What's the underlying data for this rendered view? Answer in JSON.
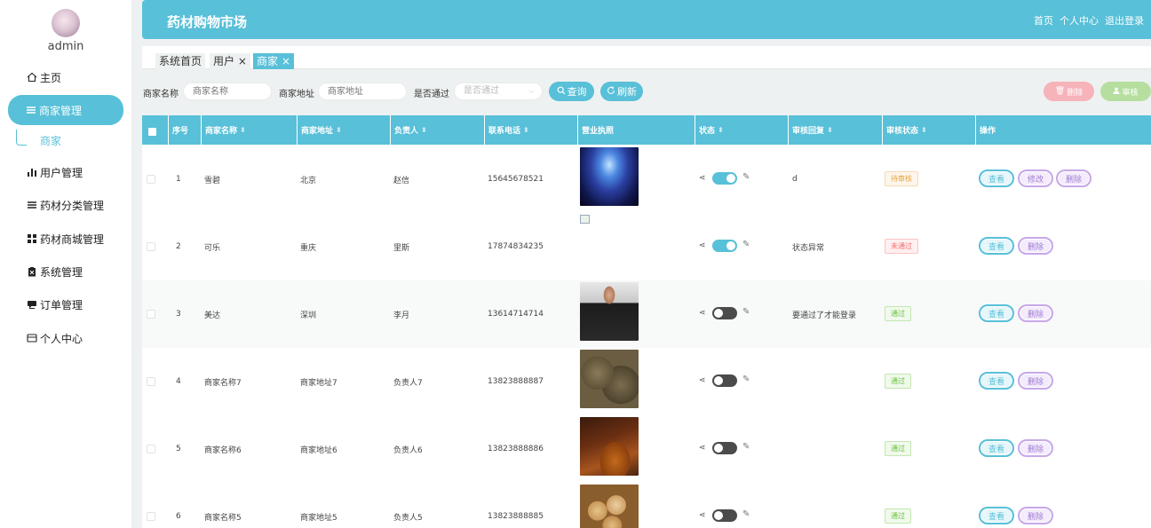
{
  "user": {
    "name": "admin"
  },
  "header": {
    "title": "药材购物市场",
    "links": [
      "首页",
      "个人中心",
      "退出登录"
    ]
  },
  "sidebar": {
    "items": [
      {
        "label": "主页",
        "icon": "home-icon"
      },
      {
        "label": "商家管理",
        "icon": "list-icon"
      },
      {
        "label": "用户管理",
        "icon": "bar-chart-icon"
      },
      {
        "label": "药材分类管理",
        "icon": "list-icon"
      },
      {
        "label": "药材商城管理",
        "icon": "grid-icon"
      },
      {
        "label": "系统管理",
        "icon": "clipboard-icon"
      },
      {
        "label": "订单管理",
        "icon": "chat-icon"
      },
      {
        "label": "个人中心",
        "icon": "card-icon"
      }
    ],
    "sub_item": "商家"
  },
  "tabs": [
    "系统首页",
    "用户",
    "商家"
  ],
  "filters": {
    "name_label": "商家名称",
    "name_placeholder": "商家名称",
    "address_label": "商家地址",
    "address_placeholder": "商家地址",
    "passed_label": "是否通过",
    "passed_placeholder": "是否通过",
    "query": "查询",
    "refresh": "刷新",
    "delete": "删除",
    "audit": "审核"
  },
  "table": {
    "columns": [
      "序号",
      "商家名称",
      "商家地址",
      "负责人",
      "联系电话",
      "营业执照",
      "状态",
      "审核回复",
      "审核状态",
      "操作"
    ],
    "rows": [
      {
        "no": "1",
        "name": "雪碧",
        "address": "北京",
        "owner": "赵信",
        "phone": "15645678521",
        "image": "galaxy",
        "status_on": true,
        "reply": "d",
        "audit": "待审核",
        "audit_type": "pending",
        "actions": [
          "查看",
          "修改",
          "删除"
        ]
      },
      {
        "no": "2",
        "name": "可乐",
        "address": "重庆",
        "owner": "里斯",
        "phone": "17874834235",
        "image": "broken",
        "status_on": true,
        "reply": "状态异常",
        "audit": "未通过",
        "audit_type": "fail",
        "actions": [
          "查看",
          "删除"
        ]
      },
      {
        "no": "3",
        "name": "美达",
        "address": "深圳",
        "owner": "李月",
        "phone": "13614714714",
        "image": "portrait",
        "status_on": false,
        "reply": "要通过了才能登录",
        "audit": "通过",
        "audit_type": "pass",
        "actions": [
          "查看",
          "删除"
        ]
      },
      {
        "no": "4",
        "name": "商家名称7",
        "address": "商家地址7",
        "owner": "负责人7",
        "phone": "13823888887",
        "image": "seeds",
        "status_on": false,
        "reply": "",
        "audit": "通过",
        "audit_type": "pass",
        "actions": [
          "查看",
          "删除"
        ]
      },
      {
        "no": "5",
        "name": "商家名称6",
        "address": "商家地址6",
        "owner": "负责人6",
        "phone": "13823888886",
        "image": "tea",
        "status_on": false,
        "reply": "",
        "audit": "通过",
        "audit_type": "pass",
        "actions": [
          "查看",
          "删除"
        ]
      },
      {
        "no": "6",
        "name": "商家名称5",
        "address": "商家地址5",
        "owner": "负责人5",
        "phone": "13823888885",
        "image": "slices",
        "status_on": false,
        "reply": "",
        "audit": "通过",
        "audit_type": "pass",
        "actions": [
          "查看",
          "删除"
        ]
      }
    ]
  },
  "colors": {
    "accent": "#58c0d8",
    "background": "#eef1f1"
  }
}
